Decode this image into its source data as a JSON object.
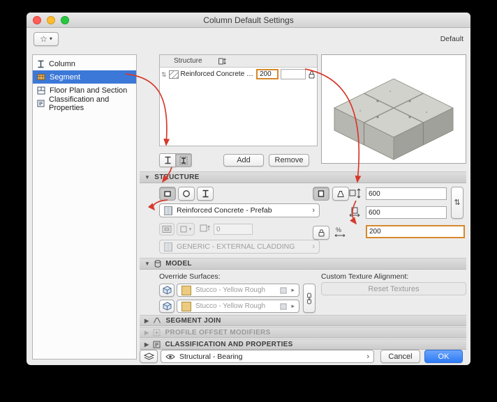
{
  "window": {
    "title": "Column Default Settings",
    "default_label": "Default"
  },
  "sidebar": {
    "items": [
      {
        "label": "Column"
      },
      {
        "label": "Segment"
      },
      {
        "label": "Floor Plan and Section"
      },
      {
        "label": "Classification and Properties"
      }
    ]
  },
  "structure_table": {
    "header": "Structure",
    "row": {
      "name": "Reinforced Concrete - Prefab",
      "value": "200"
    }
  },
  "structure_list": {
    "add_label": "Add",
    "remove_label": "Remove"
  },
  "structure_section": {
    "title": "STRUCTURE",
    "material_name": "Reinforced Concrete - Prefab",
    "veneer_value": "0",
    "cladding_name": "GENERIC - EXTERNAL CLADDING",
    "width_value": "600",
    "depth_value": "600",
    "height_value": "200"
  },
  "model_section": {
    "title": "MODEL",
    "override_surfaces_label": "Override Surfaces:",
    "custom_texture_label": "Custom Texture Alignment:",
    "reset_textures_label": "Reset Textures",
    "surfaces": [
      {
        "name": "Stucco - Yellow Rough"
      },
      {
        "name": "Stucco - Yellow Rough"
      }
    ]
  },
  "sections": {
    "segment_join": "SEGMENT JOIN",
    "profile_offset_modifiers": "PROFILE OFFSET MODIFIERS",
    "classification_properties": "CLASSIFICATION AND PROPERTIES"
  },
  "footer": {
    "layer_name": "Structural - Bearing",
    "cancel_label": "Cancel",
    "ok_label": "OK"
  },
  "colors": {
    "selection_blue": "#3c78d8",
    "highlight_orange": "#d6882a",
    "annotation_red": "#d6392b",
    "ok_blue": "#2e7bf6"
  }
}
